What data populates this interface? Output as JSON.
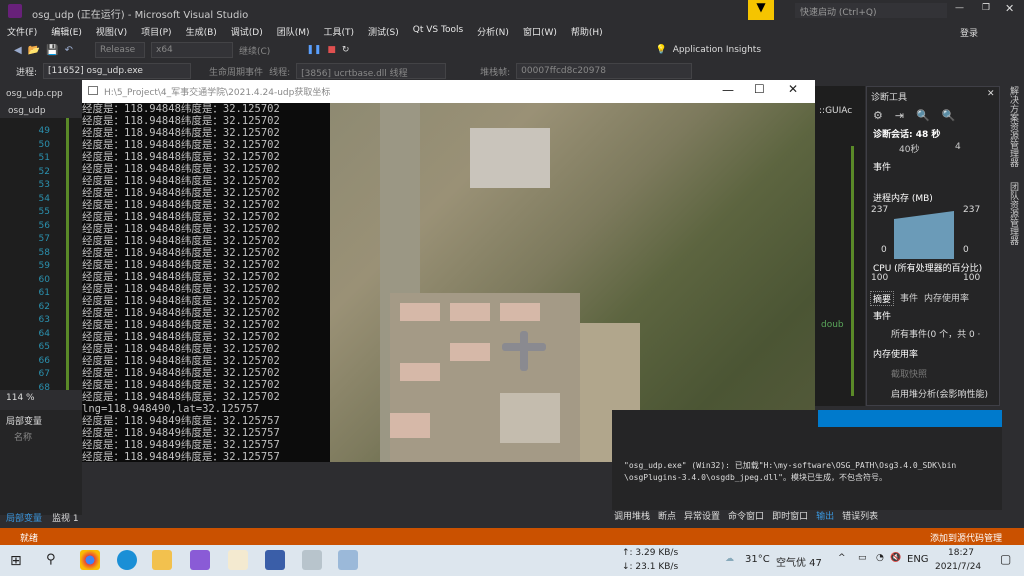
{
  "window": {
    "title": "osg_udp (正在运行) - Microsoft Visual Studio",
    "quick_launch": "快速启动 (Ctrl+Q)",
    "sign_in": "登录"
  },
  "menu": [
    "文件(F)",
    "编辑(E)",
    "视图(V)",
    "项目(P)",
    "生成(B)",
    "调试(D)",
    "团队(M)",
    "工具(T)",
    "测试(S)",
    "Qt VS Tools",
    "分析(N)",
    "窗口(W)",
    "帮助(H)"
  ],
  "toolbar": {
    "config": "Release",
    "platform": "x64",
    "continue": "继续(C)",
    "app_insights": "Application Insights"
  },
  "debugbar": {
    "process_label": "进程:",
    "process": "[11652] osg_udp.exe",
    "lifecycle": "生命周期事件",
    "thread_label": "线程:",
    "thread": "[3856] ucrtbase.dll 线程",
    "stack_label": "堆栈帧:",
    "stack": "00007ffcd8c20978"
  },
  "editor": {
    "tab": "osg_udp.cpp",
    "scope": "osg_udp",
    "lines": [
      "49",
      "50",
      "51",
      "52",
      "53",
      "54",
      "55",
      "56",
      "57",
      "58",
      "59",
      "60",
      "61",
      "62",
      "63",
      "64",
      "65",
      "66",
      "67",
      "68"
    ],
    "zoom": "114 %",
    "right_scope": "::GUIAc",
    "right_code": "doub"
  },
  "console": {
    "title": "H:\\5_Project\\4_军事交通学院\\2021.4.24-udp获取坐标",
    "lines_a": "经度是：118.94848纬度是：32.125702",
    "lines_a_count": 25,
    "lng_line": "lng=118.948490,lat=32.125757",
    "lines_b": "经度是：118.94849纬度是：32.125757",
    "lines_b_count": 4,
    "prompt": "经度是："
  },
  "locals": {
    "title": "局部变量",
    "column": "名称",
    "tabs": [
      "局部变量",
      "监视 1"
    ]
  },
  "diagnostics": {
    "title": "诊断工具",
    "session": "诊断会话: 48 秒",
    "timeline": "40秒",
    "timeline_right": "4",
    "events": "事件",
    "memory": "进程内存 (MB)",
    "mem_max": "237",
    "mem_min": "0",
    "cpu": "CPU (所有处理器的百分比)",
    "cpu_max": "100",
    "tabs": [
      "摘要",
      "事件",
      "内存使用率"
    ],
    "section_events": "事件",
    "all_events": "所有事件(0 个，共 0 ·",
    "section_memory": "内存使用率",
    "snapshot": "截取快照",
    "heap": "启用堆分析(会影响性能)"
  },
  "side_tabs": [
    "解决方案资源管理器",
    "团队资源管理器"
  ],
  "output": {
    "line1": "\"osg_udp.exe\" (Win32): 已加载\"H:\\my-software\\OSG_PATH\\Osg3.4.0_SDK\\bin",
    "line2": "\\osgPlugins-3.4.0\\osgdb_jpeg.dll\"。模块已生成，不包含符号。",
    "tabs": [
      "调用堆栈",
      "断点",
      "异常设置",
      "命令窗口",
      "即时窗口",
      "输出",
      "错误列表"
    ]
  },
  "status": {
    "ready": "就绪",
    "source_control": "添加到源代码管理"
  },
  "taskbar": {
    "net_up": "↑: 3.29 KB/s",
    "net_down": "↓: 23.1 KB/s",
    "weather": "31°C",
    "air": "空气优 47",
    "lang": "ENG",
    "time": "18:27",
    "date": "2021/7/24"
  },
  "colors": {
    "status": "#ca5100",
    "accent": "#007acc",
    "vs": "#68217a"
  }
}
